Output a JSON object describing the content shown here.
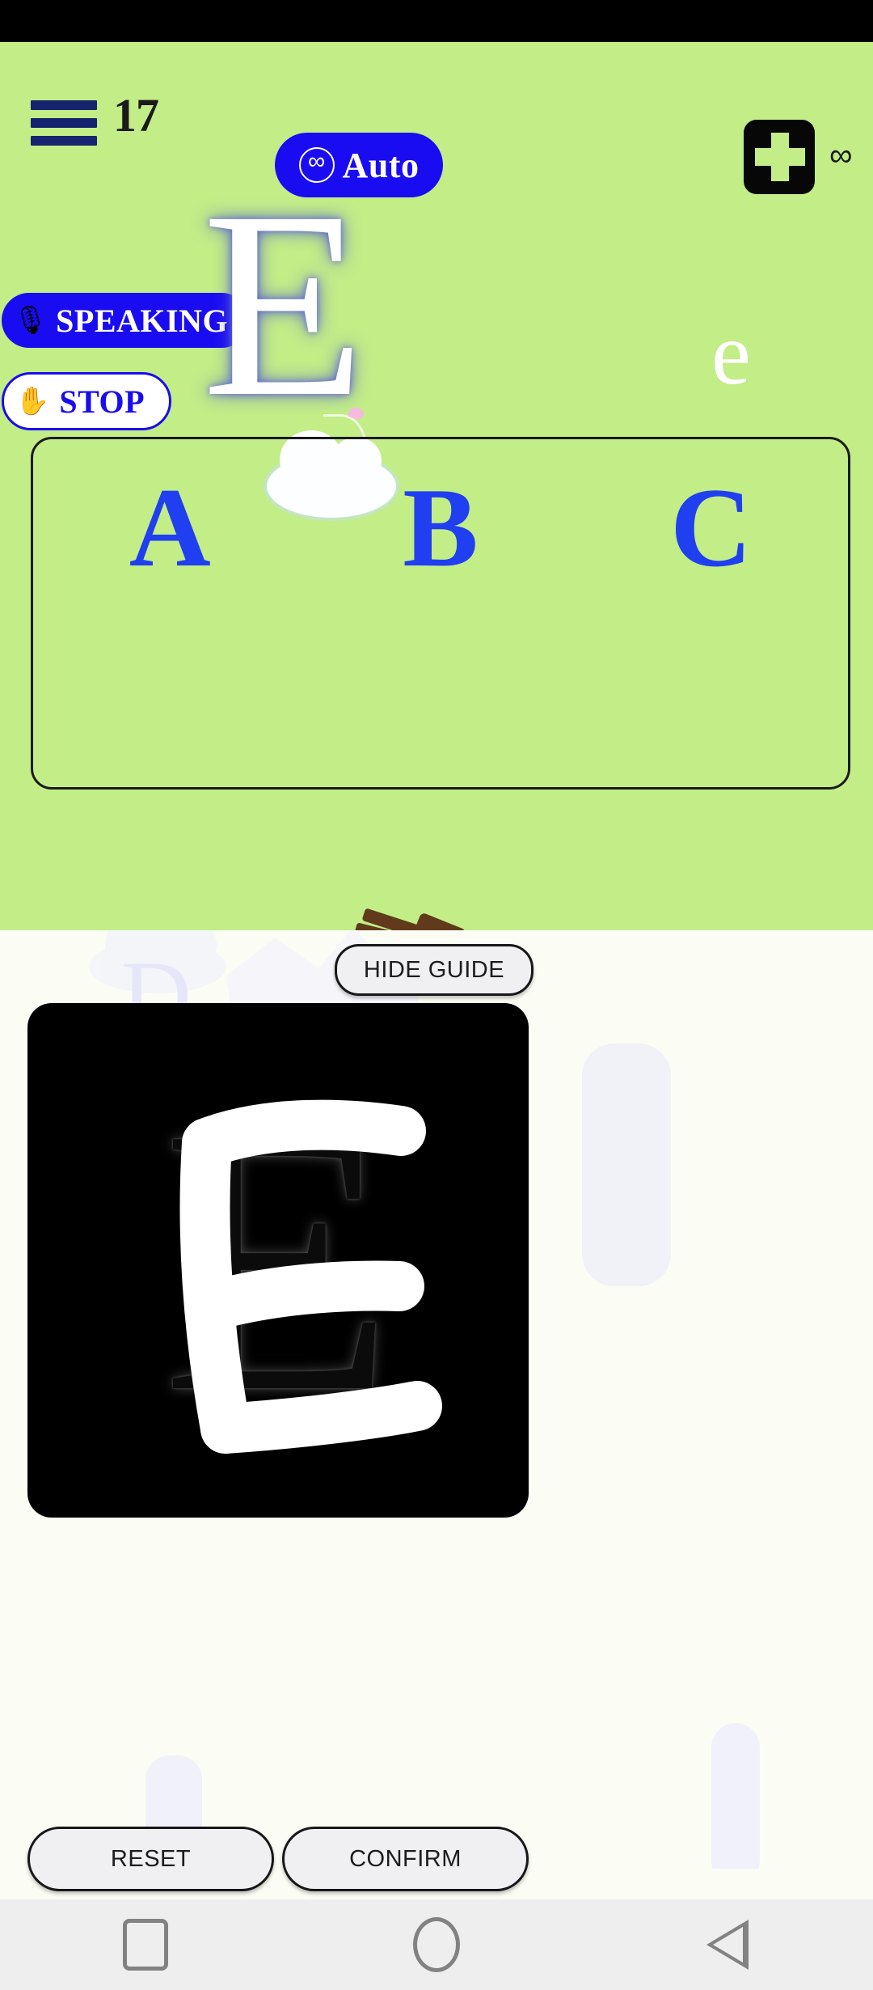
{
  "app": {
    "background_green": "#c2ed87",
    "accent_blue": "#1a0cf0",
    "panel_pale": "#fbfdf4"
  },
  "topbar": {
    "menu_icon": "hamburger-menu-icon",
    "level_count": "17",
    "auto_button": {
      "icon": "circled-infinity-icon",
      "icon_glyph": "∞",
      "label": "Auto"
    },
    "health_icon": "health-cross-icon",
    "lives_value": "∞"
  },
  "speech": {
    "speaking_button": {
      "icon": "microphone-icon",
      "icon_glyph": "🎙",
      "label": "SPEAKING"
    },
    "stop_button": {
      "icon": "raised-hand-icon",
      "icon_glyph": "✋",
      "label": "STOP"
    }
  },
  "prompt": {
    "uppercase_letter": "E",
    "lowercase_letter": "e"
  },
  "choices": {
    "options": [
      {
        "label": "A"
      },
      {
        "label": "B"
      },
      {
        "label": "C"
      }
    ]
  },
  "guide": {
    "hide_guide_label": "HIDE GUIDE"
  },
  "canvas": {
    "guide_letter": "E",
    "background_color": "#000000",
    "ink_color": "#ffffff"
  },
  "actions": {
    "reset_label": "RESET",
    "confirm_label": "CONFIRM"
  },
  "navbar": {
    "recents_icon": "square-recents-icon",
    "home_icon": "circle-home-icon",
    "back_icon": "triangle-back-icon"
  }
}
